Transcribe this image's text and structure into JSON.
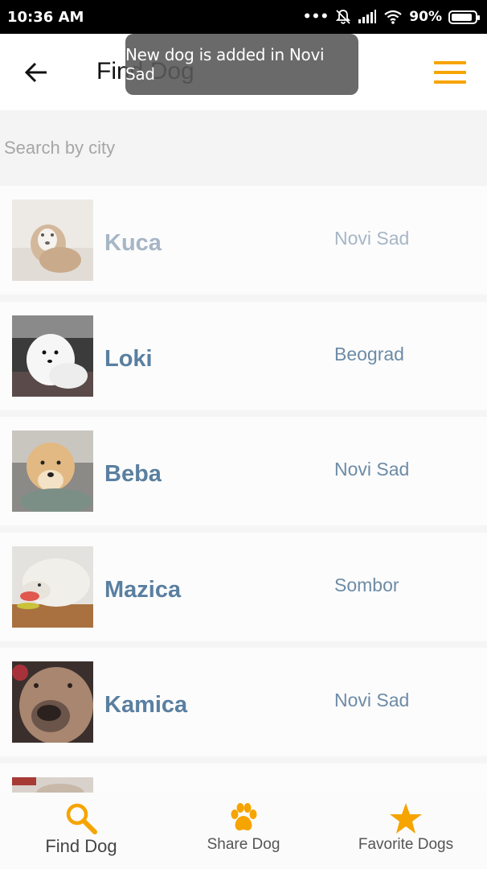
{
  "status_bar": {
    "time": "10:36 AM",
    "battery": "90%",
    "battery_level": 0.9
  },
  "app_bar": {
    "title": "Find Dog"
  },
  "toast": {
    "message": "New dog is added in Novi Sad"
  },
  "search": {
    "placeholder": "Search by city",
    "value": ""
  },
  "dogs": [
    {
      "name": "Kuca",
      "city": "Novi Sad"
    },
    {
      "name": "Loki",
      "city": "Beograd"
    },
    {
      "name": "Beba",
      "city": "Novi Sad"
    },
    {
      "name": "Mazica",
      "city": "Sombor"
    },
    {
      "name": "Kamica",
      "city": "Novi Sad"
    },
    {
      "name": "",
      "city": ""
    }
  ],
  "bottom_nav": [
    {
      "label": "Find Dog",
      "icon": "search-icon"
    },
    {
      "label": "Share Dog",
      "icon": "paw-icon"
    },
    {
      "label": "Favorite Dogs",
      "icon": "star-icon"
    }
  ],
  "colors": {
    "accent": "#f6a400",
    "name_text": "#5a7fa0",
    "city_text": "#6d8ba6"
  }
}
